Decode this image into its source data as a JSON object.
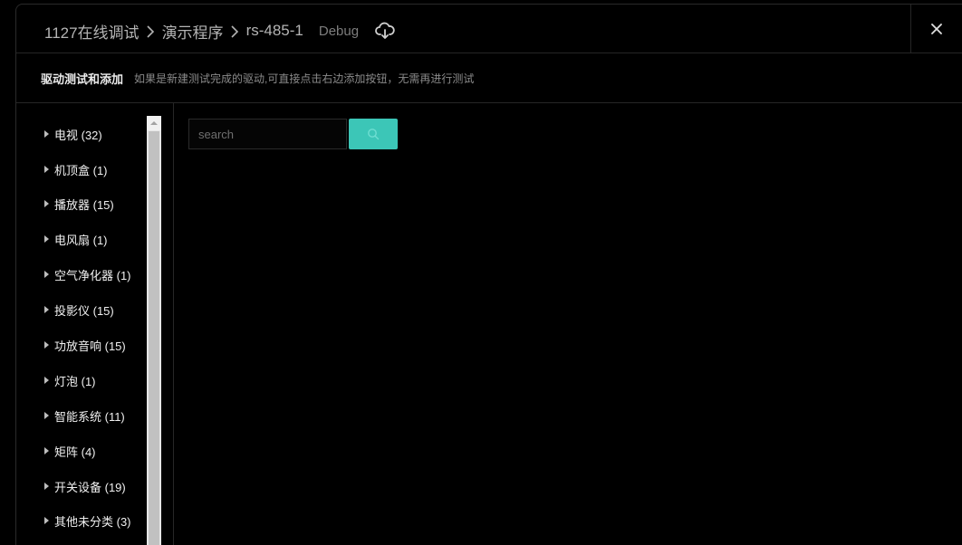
{
  "header": {
    "breadcrumbs": [
      "1127在线调试",
      "演示程序",
      "rs-485-1"
    ],
    "mode": "Debug",
    "cloud_icon": "cloud-sync-icon",
    "close_icon": "close-icon"
  },
  "subheader": {
    "title": "驱动测试和添加",
    "description": "如果是新建测试完成的驱动,可直接点击右边添加按钮，无需再进行测试"
  },
  "sidebar": {
    "items": [
      {
        "label": "电视 (32)"
      },
      {
        "label": "机顶盒 (1)"
      },
      {
        "label": "播放器 (15)"
      },
      {
        "label": "电风扇 (1)"
      },
      {
        "label": "空气净化器 (1)"
      },
      {
        "label": "投影仪 (15)"
      },
      {
        "label": "功放音响 (15)"
      },
      {
        "label": "灯泡 (1)"
      },
      {
        "label": "智能系统 (11)"
      },
      {
        "label": "矩阵 (4)"
      },
      {
        "label": "开关设备 (19)"
      },
      {
        "label": "其他未分类 (3)"
      }
    ]
  },
  "search": {
    "placeholder": "search",
    "value": "",
    "button_icon": "search-icon"
  },
  "colors": {
    "accent": "#3cc6b7",
    "background": "#000000"
  }
}
